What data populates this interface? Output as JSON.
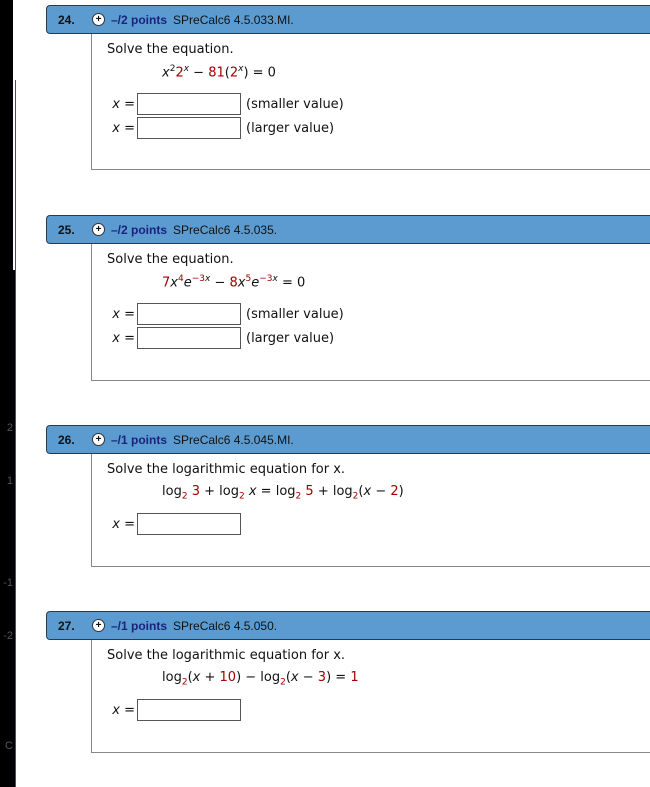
{
  "side_axis": [
    "2",
    "1",
    "-1",
    "-2",
    "C"
  ],
  "questions": [
    {
      "number": "24.",
      "points": "–/2 points",
      "code": "SPreCalc6 4.5.033.MI.",
      "prompt": "Solve the equation.",
      "equation": [
        {
          "t": "x",
          "i": 1
        },
        {
          "t": "2",
          "sup": 1
        },
        {
          "t": "2",
          "r": 1
        },
        {
          "t": "x",
          "sup": 1,
          "i": 1
        },
        {
          "t": " − "
        },
        {
          "t": "81",
          "r": 1
        },
        {
          "t": "("
        },
        {
          "t": "2",
          "r": 1
        },
        {
          "t": "x",
          "sup": 1,
          "i": 1
        },
        {
          "t": ") = 0"
        }
      ],
      "answers": [
        {
          "label": "x =",
          "value": "",
          "note": "(smaller value)"
        },
        {
          "label": "x =",
          "value": "",
          "note": "(larger value)"
        }
      ]
    },
    {
      "number": "25.",
      "points": "–/2 points",
      "code": "SPreCalc6 4.5.035.",
      "prompt": "Solve the equation.",
      "equation": [
        {
          "t": "7",
          "r": 1
        },
        {
          "t": "x",
          "i": 1
        },
        {
          "t": "4",
          "sup": 1,
          "r": 1
        },
        {
          "t": "e",
          "i": 1
        },
        {
          "t": "−3",
          "sup": 1,
          "r": 1
        },
        {
          "t": "x",
          "sup": 1,
          "i": 1
        },
        {
          "t": " − "
        },
        {
          "t": "8",
          "r": 1
        },
        {
          "t": "x",
          "i": 1
        },
        {
          "t": "5",
          "sup": 1,
          "r": 1
        },
        {
          "t": "e",
          "i": 1
        },
        {
          "t": "−3",
          "sup": 1,
          "r": 1
        },
        {
          "t": "x",
          "sup": 1,
          "i": 1
        },
        {
          "t": " = 0"
        }
      ],
      "answers": [
        {
          "label": "x =",
          "value": "",
          "note": "(smaller value)"
        },
        {
          "label": "x =",
          "value": "",
          "note": "(larger value)"
        }
      ]
    },
    {
      "number": "26.",
      "points": "–/1 points",
      "code": "SPreCalc6 4.5.045.MI.",
      "prompt": "Solve the logarithmic equation for x.",
      "equation": [
        {
          "t": "log"
        },
        {
          "t": "2",
          "sub": 1,
          "r": 1
        },
        {
          "t": " "
        },
        {
          "t": "3",
          "r": 1
        },
        {
          "t": " + log"
        },
        {
          "t": "2",
          "sub": 1,
          "r": 1
        },
        {
          "t": " "
        },
        {
          "t": "x",
          "i": 1
        },
        {
          "t": " = log"
        },
        {
          "t": "2",
          "sub": 1,
          "r": 1
        },
        {
          "t": " "
        },
        {
          "t": "5",
          "r": 1
        },
        {
          "t": " + log"
        },
        {
          "t": "2",
          "sub": 1,
          "r": 1
        },
        {
          "t": "("
        },
        {
          "t": "x",
          "i": 1
        },
        {
          "t": " − "
        },
        {
          "t": "2",
          "r": 1
        },
        {
          "t": ")"
        }
      ],
      "answers": [
        {
          "label": "x =",
          "value": "",
          "note": ""
        }
      ]
    },
    {
      "number": "27.",
      "points": "–/1 points",
      "code": "SPreCalc6 4.5.050.",
      "prompt": "Solve the logarithmic equation for x.",
      "equation": [
        {
          "t": "log"
        },
        {
          "t": "2",
          "sub": 1,
          "r": 1
        },
        {
          "t": "("
        },
        {
          "t": "x",
          "i": 1
        },
        {
          "t": " + "
        },
        {
          "t": "10",
          "r": 1
        },
        {
          "t": ") − log"
        },
        {
          "t": "2",
          "sub": 1,
          "r": 1
        },
        {
          "t": "("
        },
        {
          "t": "x",
          "i": 1
        },
        {
          "t": " − "
        },
        {
          "t": "3",
          "r": 1
        },
        {
          "t": ") = "
        },
        {
          "t": "1",
          "r": 1
        }
      ],
      "answers": [
        {
          "label": "x =",
          "value": "",
          "note": ""
        }
      ]
    }
  ]
}
